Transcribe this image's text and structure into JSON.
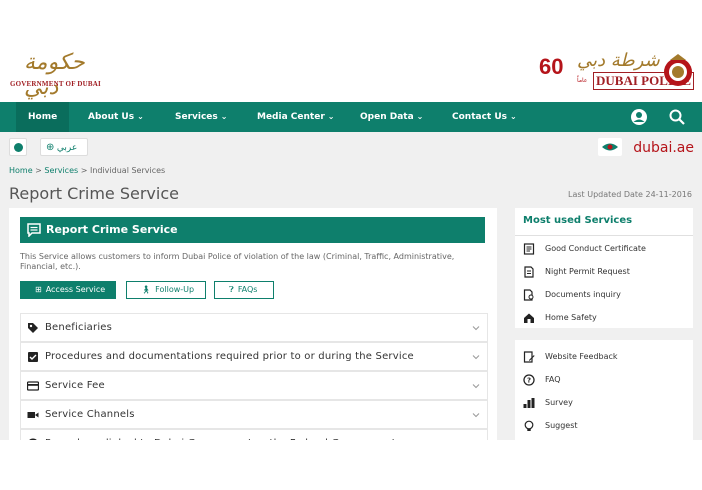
{
  "header": {
    "gov_logo_arabic": "حكومة دبي",
    "gov_logo_text": "GOVERNMENT OF DUBAI",
    "police_logo_arabic": "شرطة دبي",
    "police_logo_text": "DUBAI POLICE",
    "police_anniversary": "60",
    "police_sub": "عاماً"
  },
  "nav": {
    "items": [
      {
        "label": "Home"
      },
      {
        "label": "About Us"
      },
      {
        "label": "Services"
      },
      {
        "label": "Media Center"
      },
      {
        "label": "Open Data"
      },
      {
        "label": "Contact Us"
      }
    ],
    "chevron": "⌄"
  },
  "toolbar": {
    "lang_label": "عربي",
    "dubai_ae": "dubai",
    "dubai_ae_suffix": ".ae"
  },
  "breadcrumb": {
    "home": "Home",
    "sep": ">",
    "services": "Services",
    "current": "Individual Services"
  },
  "page": {
    "title": "Report Crime Service",
    "updated": "Last Updated Date 24-11-2016"
  },
  "card": {
    "title": "Report Crime Service",
    "description": "This Service allows customers to inform Dubai Police of violation of the law (Criminal, Traffic, Administrative, Financial, etc.).",
    "buttons": {
      "access": "Access Service",
      "follow": "Follow-Up",
      "faq": "FAQs"
    },
    "accordion": [
      {
        "label": "Beneficiaries"
      },
      {
        "label": "Procedures and documentations required prior to or during the Service"
      },
      {
        "label": "Service Fee"
      },
      {
        "label": "Service Channels"
      },
      {
        "label": "Procedures linked to Dubai Government or the Federal Government"
      }
    ]
  },
  "sidebar": {
    "most_used_title": "Most used Services",
    "most_used": [
      {
        "label": "Good Conduct Certificate"
      },
      {
        "label": "Night Permit Request"
      },
      {
        "label": "Documents inquiry"
      },
      {
        "label": "Home Safety"
      }
    ],
    "links": [
      {
        "label": "Website Feedback"
      },
      {
        "label": "FAQ"
      },
      {
        "label": "Survey"
      },
      {
        "label": "Suggest"
      }
    ]
  },
  "colors": {
    "brand_green": "#0e7f6c",
    "brand_red": "#b5141a",
    "gold": "#a37a2c"
  }
}
